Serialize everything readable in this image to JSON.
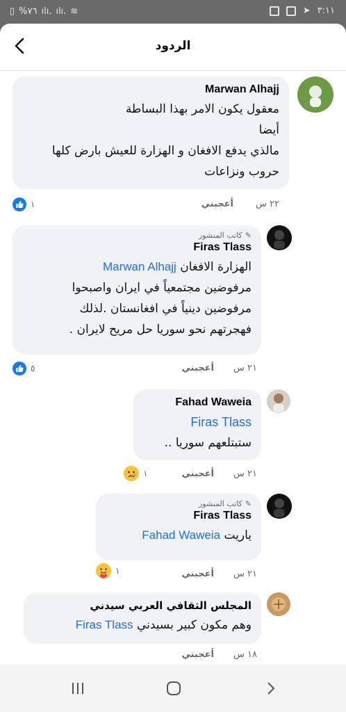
{
  "status": {
    "time": "٣:١١",
    "battery": "%٧٦"
  },
  "header": {
    "title": "الردود"
  },
  "author_badge": "كاتب المنشور",
  "like_label": "أعجبني",
  "comments": [
    {
      "name": "Marwan Alhajj",
      "lines": [
        "معقول يكون الامر بهذا البساطة",
        "أيضا",
        "مالذي يدفع الافغان و الهزارة للعيش بارض كلها",
        "حروب ونزاعات"
      ],
      "time": "٢٢ س",
      "reactions": "١"
    },
    {
      "name": "Firas Tlass",
      "mention": "Marwan Alhajj",
      "first_line": "الهزارة الافغان",
      "lines": [
        "مرفوضين مجتمعياً في ايران واصبحوا",
        "مرفوضين دينياً في افغانستان .لذلك",
        "فهجرتهم نحو سوريا حل مريح لايران ."
      ],
      "time": "٢١ س",
      "reactions": "٥"
    },
    {
      "name": "Fahad Waweia",
      "mention": "Firas Tlass",
      "lines": [
        "ستبتلعهم سوريا .."
      ],
      "time": "٢١ س",
      "reactions": "١"
    },
    {
      "name": "Firas Tlass",
      "mention": "Fahad Waweia",
      "first_line": "ياريت",
      "time": "٢١ س",
      "reactions": "١"
    },
    {
      "name": "المجلس الثقافي العربي سيدني",
      "mention": "Firas Tlass",
      "first_line": "وهم مكون كبير بسيدني",
      "time": "١٨ س"
    }
  ]
}
